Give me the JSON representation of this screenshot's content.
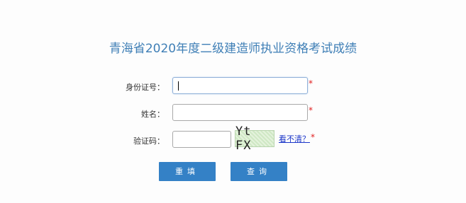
{
  "title": "青海省2020年度二级建造师执业资格考试成绩",
  "form": {
    "id_label": "身份证号：",
    "name_label": "姓名：",
    "captcha_label": "验证码：",
    "id_value": "",
    "name_value": "",
    "captcha_value": "",
    "required_mark": "*",
    "captcha_text": "Yt FX",
    "refresh_link": "看不清？"
  },
  "buttons": {
    "reset_label": "重填",
    "query_label": "查询"
  },
  "colors": {
    "title": "#3f7fb6",
    "button": "#3481c6",
    "required": "#e02020",
    "link": "#1a35c9"
  }
}
